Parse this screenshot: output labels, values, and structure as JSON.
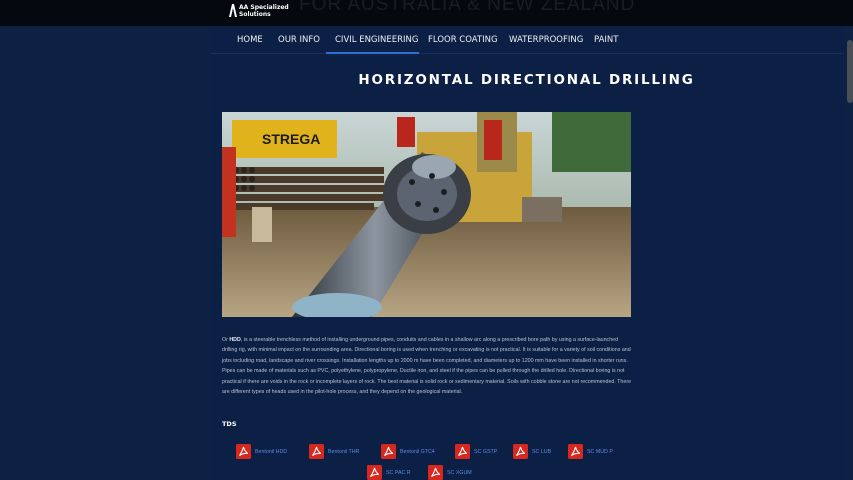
{
  "header": {
    "logo_line1": "AA Specialized",
    "logo_line2": "Solutions",
    "banner_text": "FOR AUSTRALIA & NEW ZEALAND"
  },
  "nav": {
    "items": [
      {
        "label": "HOME"
      },
      {
        "label": "OUR INFO"
      },
      {
        "label": "CIVIL ENGINEERING",
        "active": true
      },
      {
        "label": "FLOOR COATING"
      },
      {
        "label": "WATERPROOFING"
      },
      {
        "label": "PAINT"
      }
    ]
  },
  "page": {
    "title": "HORIZONTAL DIRECTIONAL DRILLING",
    "desc_lead": "Or ",
    "desc_bold": "HDD",
    "desc_rest": ", is a steerable trenchless method of installing underground pipes, conduits and cables in a shallow arc along a prescribed bore path by using a surface-launched drilling rig, with minimal impact on the surrounding area. Directional boring is used when trenching or excavating is not practical. It is suitable for a variety of soil conditions and jobs including road, landscape and river crossings. Installation lengths up to 2000 m have been completed, and diameters up to 1200 mm have been installed in shorter runs. Pipes can be made of materials such as PVC, polyethylene, polypropylene, Ductile iron, and steel if the pipes can be pulled through the drilled hole. Directional boring is not practical if there are voids in the rock or incomplete layers of rock. The best material is solid rock or sedimentary material. Soils with cobble stone are not recommended. There are different types of heads used in the pilot-hole process, and they depend on the geological material."
  },
  "tds": {
    "label": "TDS",
    "files": [
      "Bentonil HDD",
      "Bentonil THR",
      "Bentonil GTC4",
      "SC GSTP",
      "SC LUB",
      "SC MUD P",
      "SC PAC R",
      "SC XGUM"
    ]
  },
  "colors": {
    "page_bg": "#0d2145",
    "topbar_bg": "#05090f",
    "nav_active_underline": "#2e6fd1",
    "link": "#5d8de6",
    "pdf_icon": "#d6281f"
  }
}
